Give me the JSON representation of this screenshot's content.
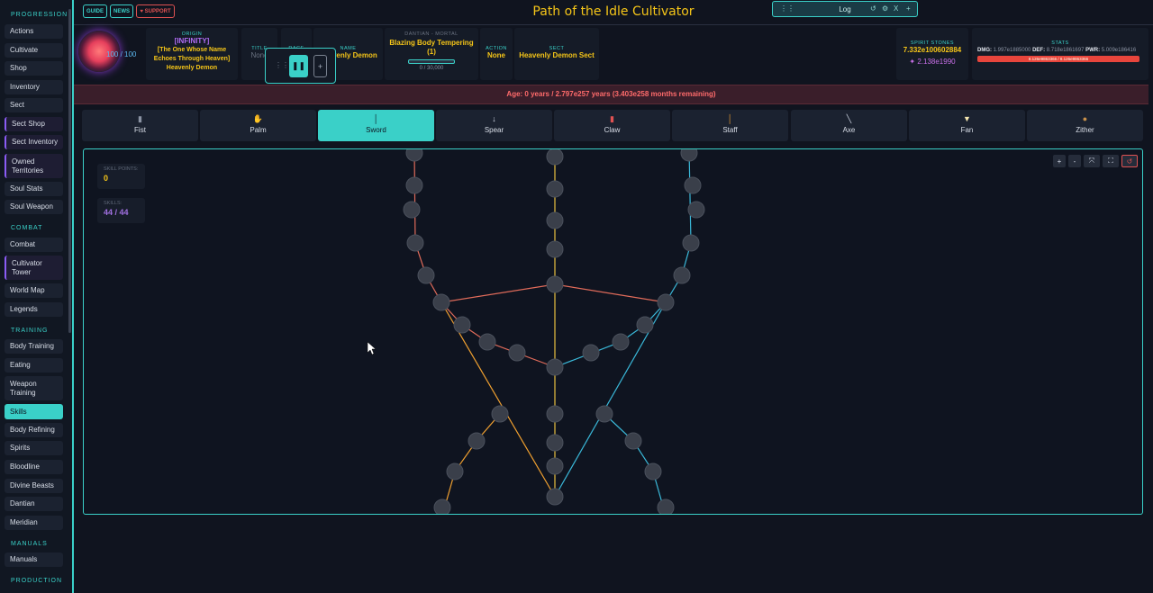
{
  "sidebar": {
    "sections": [
      {
        "title": "PROGRESSION"
      },
      {
        "title": "COMBAT"
      },
      {
        "title": "TRAINING"
      },
      {
        "title": "MANUALS"
      },
      {
        "title": "PRODUCTION"
      }
    ],
    "items": [
      {
        "label": "Actions"
      },
      {
        "label": "Cultivate"
      },
      {
        "label": "Shop"
      },
      {
        "label": "Inventory"
      },
      {
        "label": "Sect"
      },
      {
        "label": "Sect Shop"
      },
      {
        "label": "Sect Inventory"
      },
      {
        "label": "Owned Territories"
      },
      {
        "label": "Soul Stats"
      },
      {
        "label": "Soul Weapon"
      },
      {
        "label": "Combat"
      },
      {
        "label": "Cultivator Tower"
      },
      {
        "label": "World Map"
      },
      {
        "label": "Legends"
      },
      {
        "label": "Body Training"
      },
      {
        "label": "Eating"
      },
      {
        "label": "Weapon Training"
      },
      {
        "label": "Skills"
      },
      {
        "label": "Body Refining"
      },
      {
        "label": "Spirits"
      },
      {
        "label": "Bloodline"
      },
      {
        "label": "Divine Beasts"
      },
      {
        "label": "Dantian"
      },
      {
        "label": "Meridian"
      },
      {
        "label": "Manuals"
      }
    ]
  },
  "topbar": {
    "title": "Path of the Idle Cultivator",
    "guide": "GUIDE",
    "news": "NEWS",
    "support": "♥ SUPPORT",
    "log": "Log"
  },
  "info": {
    "hp": "100 / 100",
    "origin_label": "ORIGIN",
    "origin_tag": "[INFINITY]",
    "origin_text": "[The One Whose Name Echoes Through Heaven]",
    "origin_name": "Heavenly Demon",
    "title_label": "TITLE",
    "title_value": "None",
    "race_label": "RACE",
    "name_label": "NAME",
    "name_value": "Heavenly Demon",
    "dantian_label": "DANTIAN - MORTAL",
    "dantian_value": "Blazing Body Tempering (1)",
    "dantian_progress": "0 / 30,000",
    "action_label": "ACTION",
    "action_value": "None",
    "sect_label": "SECT",
    "sect_value": "Heavenly Demon Sect",
    "stones_label": "SPIRIT STONES",
    "stones_value": "7.332e100602884",
    "stones_secondary": "2.138e1990",
    "stats_label": "STATS",
    "dmg_label": "DMG:",
    "dmg_value": "1.997e1885000",
    "def_label": "DEF:",
    "def_value": "8.718e1861697",
    "pwr_label": "PWR:",
    "pwr_value": "5.009e186416",
    "hp_bar_text": "8.126e9863366 / 8.126e9863366",
    "hp_fraction": 1.0
  },
  "age": {
    "text": "Age: 0 years / 2.797e257 years (3.403e258 months remaining)"
  },
  "tabs": [
    {
      "label": "Fist",
      "icon": "fist-icon"
    },
    {
      "label": "Palm",
      "icon": "palm-icon"
    },
    {
      "label": "Sword",
      "icon": "sword-icon"
    },
    {
      "label": "Spear",
      "icon": "spear-icon"
    },
    {
      "label": "Claw",
      "icon": "claw-icon"
    },
    {
      "label": "Staff",
      "icon": "staff-icon"
    },
    {
      "label": "Axe",
      "icon": "axe-icon"
    },
    {
      "label": "Fan",
      "icon": "fan-icon"
    },
    {
      "label": "Zither",
      "icon": "zither-icon"
    }
  ],
  "tree": {
    "skill_points_label": "SKILL POINTS:",
    "skill_points": "0",
    "skills_label": "SKILLS:",
    "skills": "44 / 44",
    "colors": {
      "red": "#e06b5a",
      "orange": "#f0a030",
      "blue": "#3ab8d8",
      "yellow": "#e8c040"
    }
  }
}
